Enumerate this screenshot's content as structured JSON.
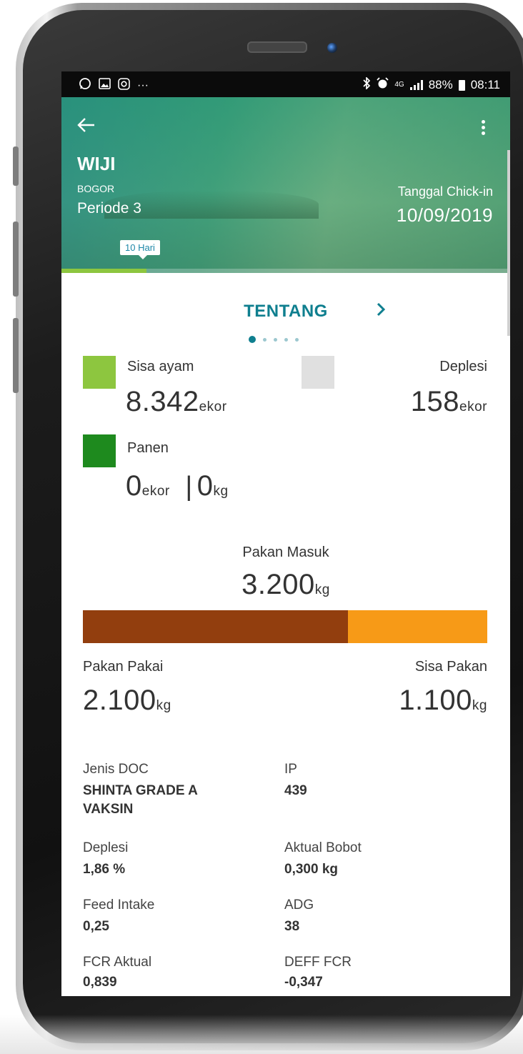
{
  "status_bar": {
    "left_icons": [
      "whatsapp-icon",
      "gallery-icon",
      "instagram-icon",
      "more-notifications-icon"
    ],
    "more_text": "···",
    "network": "4G",
    "battery": "88%",
    "time": "08:11"
  },
  "header": {
    "farm_name": "WIJI",
    "location": "BOGOR",
    "period": "Periode  3",
    "chickin_label": "Tanggal Chick-in",
    "chickin_date": "10/09/2019",
    "day_badge": "10 Hari",
    "day_progress": 0.19
  },
  "pager": {
    "title": "TENTANG",
    "next_icon": "chevron-right-icon",
    "page_count": 5,
    "active_page": 0
  },
  "stats": {
    "sisa_ayam": {
      "label": "Sisa ayam",
      "value": "8.342",
      "unit": "ekor",
      "color": "#8dc63f"
    },
    "deplesi": {
      "label": "Deplesi",
      "value": "158",
      "unit": "ekor",
      "color": "#e0e0e0"
    },
    "panen": {
      "label": "Panen",
      "value_ekor": "0",
      "unit_ekor": "ekor",
      "separator": "|",
      "value_kg": "0",
      "unit_kg": "kg",
      "color": "#1e8a1e"
    }
  },
  "feed": {
    "masuk_label": "Pakan Masuk",
    "masuk_value": "3.200",
    "masuk_unit": "kg",
    "pakai_label": "Pakan Pakai",
    "pakai_value": "2.100",
    "pakai_unit": "kg",
    "sisa_label": "Sisa Pakan",
    "sisa_value": "1.100",
    "sisa_unit": "kg",
    "used_fraction": 0.656,
    "used_color": "#923e0e",
    "remaining_color": "#f79a17"
  },
  "info": {
    "jenis_doc": {
      "label": "Jenis DOC",
      "value_line1": "SHINTA GRADE A",
      "value_line2": "VAKSIN"
    },
    "ip": {
      "label": "IP",
      "value": "439"
    },
    "deplesi": {
      "label": "Deplesi",
      "value": "1,86 %"
    },
    "aktual_bobot": {
      "label": "Aktual Bobot",
      "value": "0,300 kg"
    },
    "feed_intake": {
      "label": "Feed Intake",
      "value": "0,25"
    },
    "adg": {
      "label": "ADG",
      "value": "38"
    },
    "fcr_aktual": {
      "label": "FCR Aktual",
      "value": "0,839"
    },
    "deff_fcr": {
      "label": "DEFF FCR",
      "value": "-0,347"
    }
  }
}
